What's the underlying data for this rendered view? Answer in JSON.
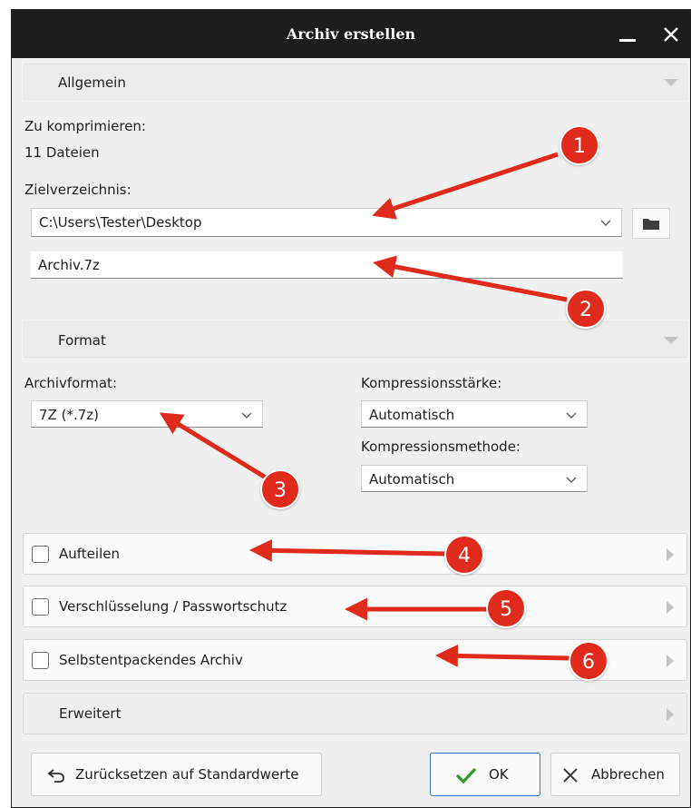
{
  "window": {
    "title": "Archiv erstellen"
  },
  "sections": {
    "general": {
      "label": "Allgemein"
    },
    "format": {
      "label": "Format"
    }
  },
  "general": {
    "to_compress_label": "Zu komprimieren:",
    "to_compress_value": "11 Dateien",
    "target_dir_label": "Zielverzeichnis:",
    "target_dir_value": "C:\\Users\\Tester\\Desktop",
    "archive_name_value": "Archiv.7z"
  },
  "format": {
    "archive_format_label": "Archivformat:",
    "archive_format_value": "7Z  (*.7z)",
    "compression_level_label": "Kompressionsstärke:",
    "compression_level_value": "Automatisch",
    "compression_method_label": "Kompressionsmethode:",
    "compression_method_value": "Automatisch"
  },
  "options": [
    {
      "label": "Aufteilen",
      "checked": false
    },
    {
      "label": "Verschlüsselung / Passwortschutz",
      "checked": false
    },
    {
      "label": "Selbstentpackendes Archiv",
      "checked": false
    }
  ],
  "advanced": {
    "label": "Erweitert"
  },
  "buttons": {
    "reset": "Zurücksetzen auf Standardwerte",
    "ok": "OK",
    "cancel": "Abbrechen"
  },
  "annotations": [
    "1",
    "2",
    "3",
    "4",
    "5",
    "6"
  ],
  "colors": {
    "titlebar": "#1d1d1d",
    "annotation": "#e02a1c",
    "ok_check": "#2a9a2a",
    "primary_border": "#3c72c5"
  },
  "icons": {
    "minimize": "minimize-icon",
    "close": "close-icon",
    "dropdown": "chevron-down-icon",
    "folder": "folder-icon",
    "reset": "undo-arrow-icon",
    "ok": "checkmark-icon",
    "cancel": "x-icon",
    "expand": "triangle-right-icon",
    "collapse": "triangle-down-icon"
  }
}
